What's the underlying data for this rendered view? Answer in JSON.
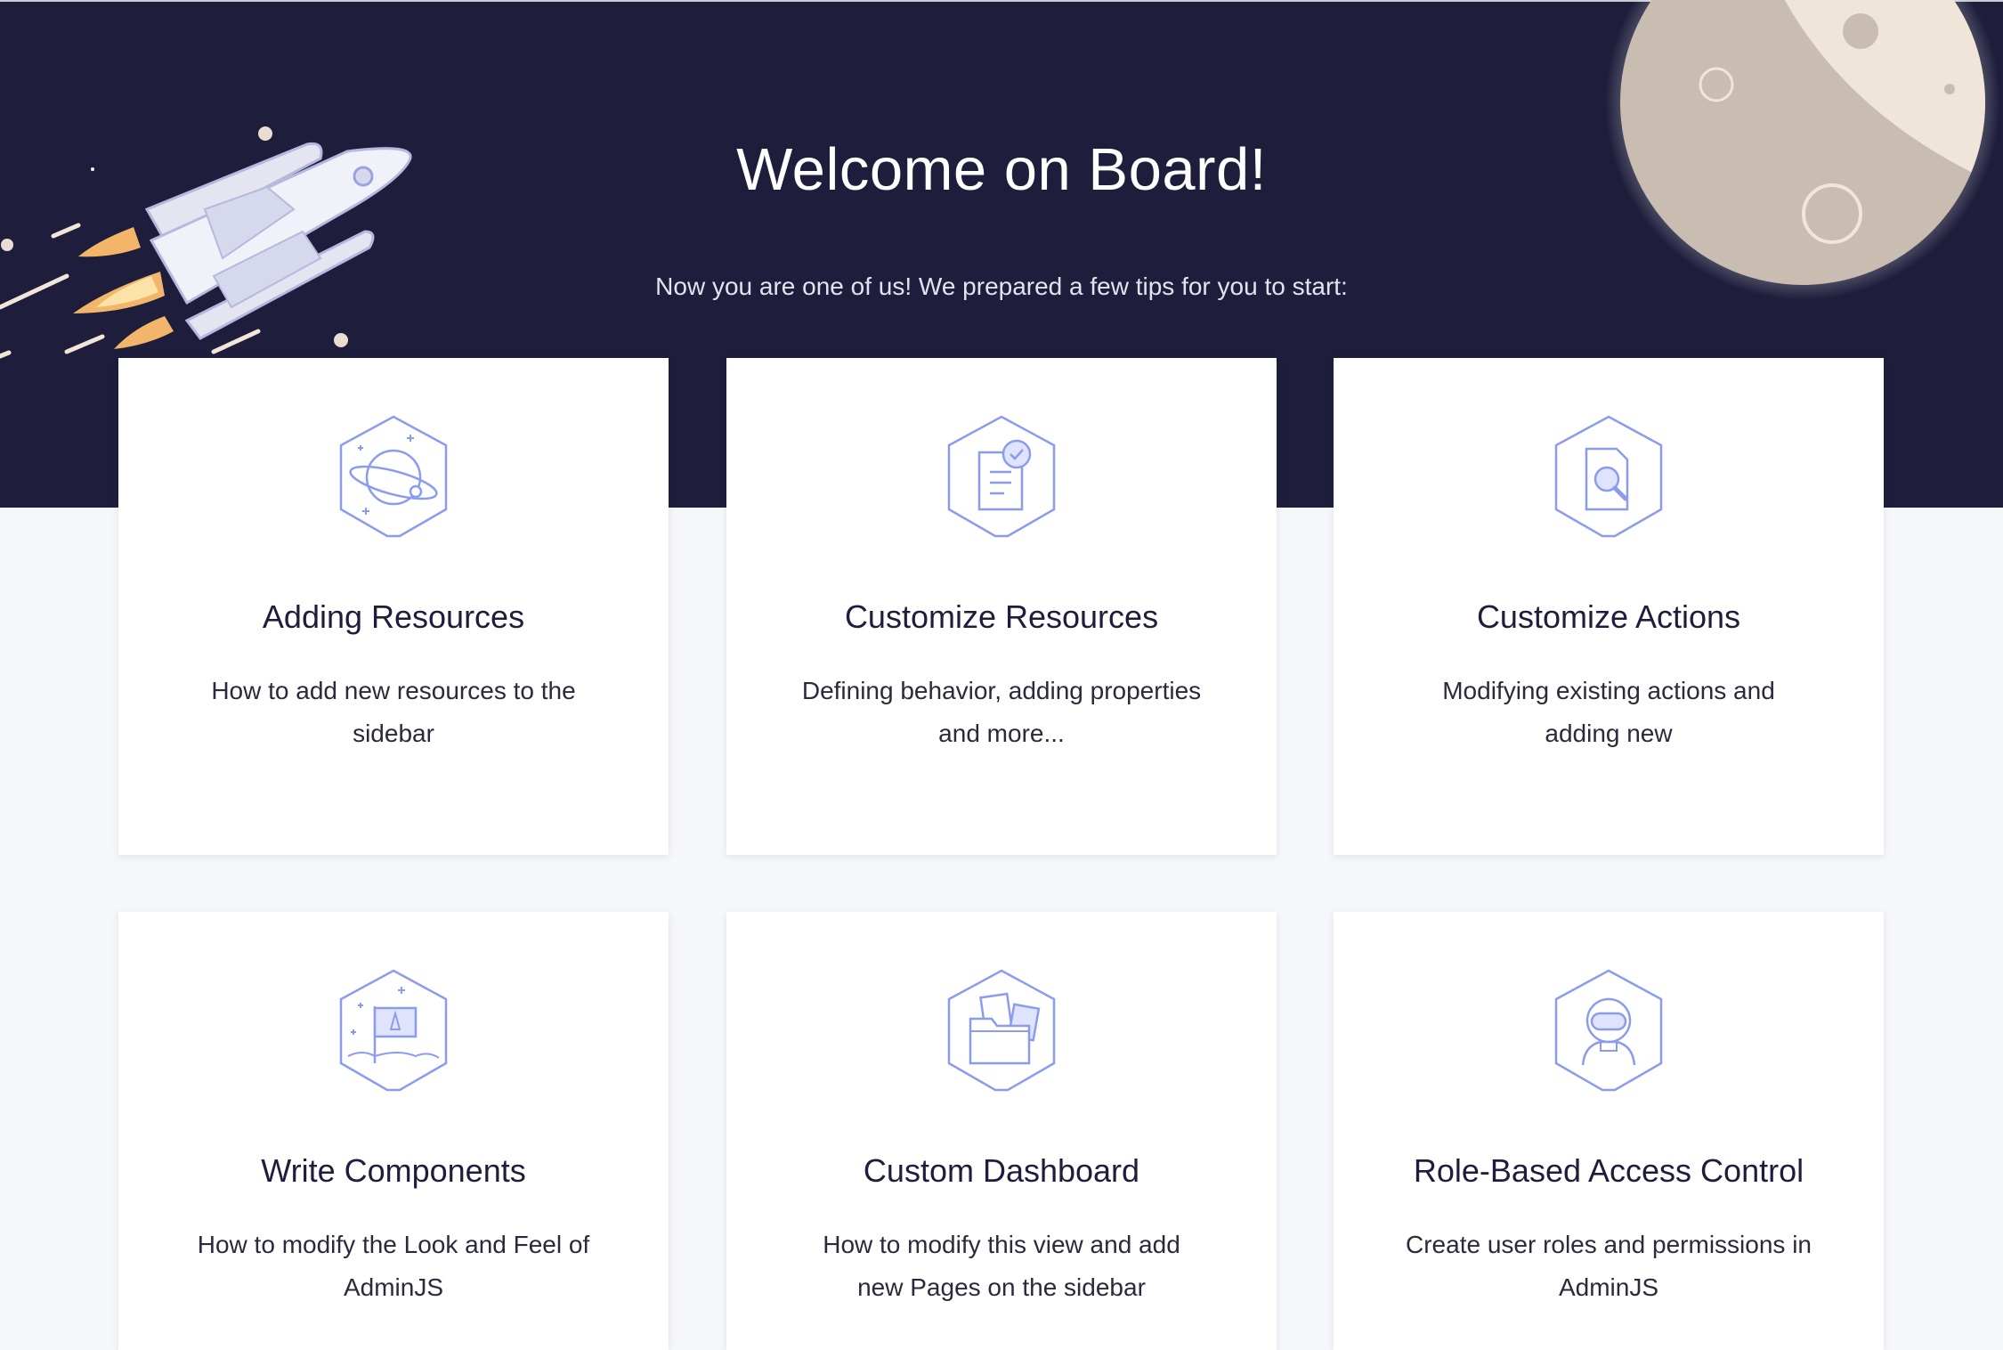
{
  "hero": {
    "title": "Welcome on Board!",
    "subtitle": "Now you are one of us! We prepared a few tips for you to start:"
  },
  "cards": [
    {
      "title": "Adding Resources",
      "description": "How to add new resources to the sidebar",
      "icon": "planet-icon"
    },
    {
      "title": "Customize Resources",
      "description": "Defining behavior, adding properties and more...",
      "icon": "document-check-icon"
    },
    {
      "title": "Customize Actions",
      "description": "Modifying existing actions and adding new",
      "icon": "document-search-icon"
    },
    {
      "title": "Write Components",
      "description": "How to modify the Look and Feel of AdminJS",
      "icon": "flag-icon"
    },
    {
      "title": "Custom Dashboard",
      "description": "How to modify this view and add new Pages on the sidebar",
      "icon": "folder-icon"
    },
    {
      "title": "Role-Based Access Control",
      "description": "Create user roles and permissions in AdminJS",
      "icon": "astronaut-icon"
    }
  ],
  "colors": {
    "hero_background": "#1e1e3c",
    "page_background": "#f6f7fb",
    "icon_accent": "#8b9cf0",
    "card_background": "#ffffff"
  }
}
